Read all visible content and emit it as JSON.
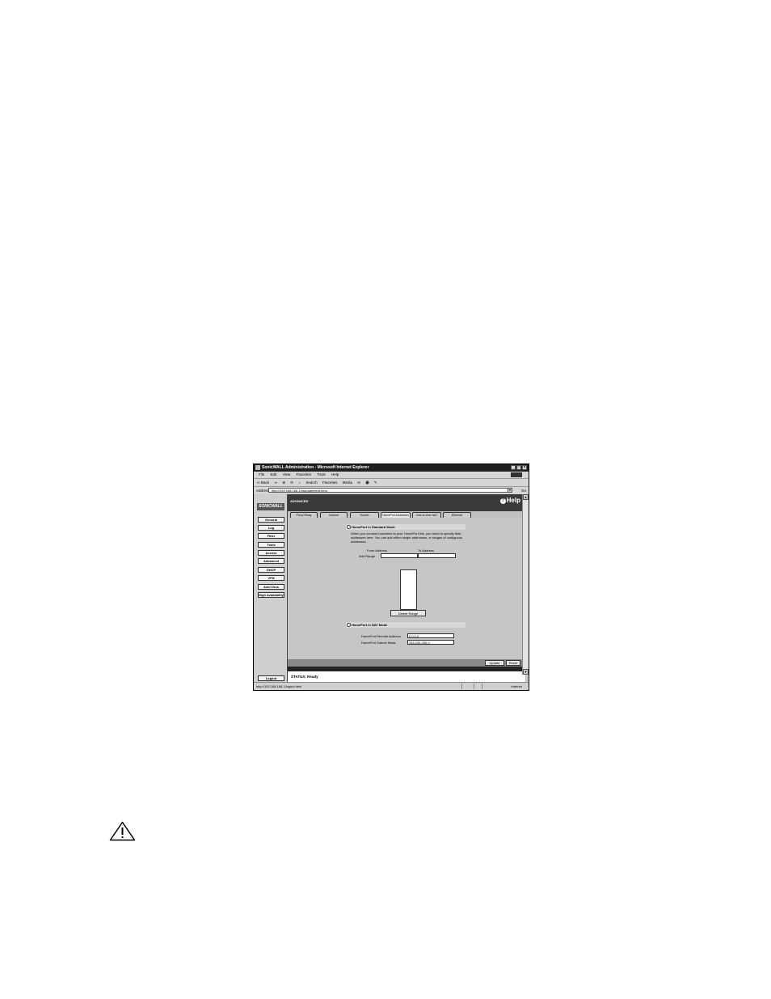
{
  "window": {
    "title": "SonicWALL Administration - Microsoft Internet Explorer",
    "controls": [
      "_",
      "□",
      "×"
    ]
  },
  "menubar": [
    "File",
    "Edit",
    "View",
    "Favorites",
    "Tools",
    "Help"
  ],
  "toolbar": [
    "⇐ Back",
    "⇒",
    "⊗",
    "⟳",
    "⌂",
    "Search",
    "Favorites",
    "Media",
    "✉",
    "🖶",
    "✎"
  ],
  "address": {
    "label": "Address",
    "url": "http://192.168.168.1/management.html",
    "go": "Go"
  },
  "sidebar": {
    "brand": "SONICWALL",
    "items": [
      "General",
      "Log",
      "Filter",
      "Tools",
      "Access",
      "Advanced",
      "DHCP",
      "VPN",
      "Anti-Virus",
      "High Availability"
    ],
    "logout": "Logout"
  },
  "header": {
    "title": "ADVANCED",
    "help": "Help"
  },
  "tabs": [
    "Proxy Relay",
    "Intranet",
    "Routes",
    "HomePort Addresses",
    "One-to-One NAT",
    "Ethernet"
  ],
  "active_tab": 3,
  "standard_mode": {
    "label": "HomePort in Standard Mode",
    "description": "When you connect machines to your HomePort link, you need to specify their addresses here. You can add either single addresses, or ranges of contiguous addresses.",
    "from_label": "From Address",
    "to_label": "To Address",
    "add_range_label": "Add Range",
    "delete_button": "Delete Range"
  },
  "nat_mode": {
    "label": "HomePort in NAT Mode",
    "remote_label": "HomePort Remote Address",
    "remote_value": "0.0.0.0",
    "mask_label": "HomePort Subnet Mask",
    "mask_value": "255.255.255.0"
  },
  "buttons": {
    "update": "Update",
    "reset": "Reset"
  },
  "status": "STATUS: Ready",
  "statusbar": {
    "url": "http://192.168.168.1/logout.html",
    "zone": "Internet"
  }
}
